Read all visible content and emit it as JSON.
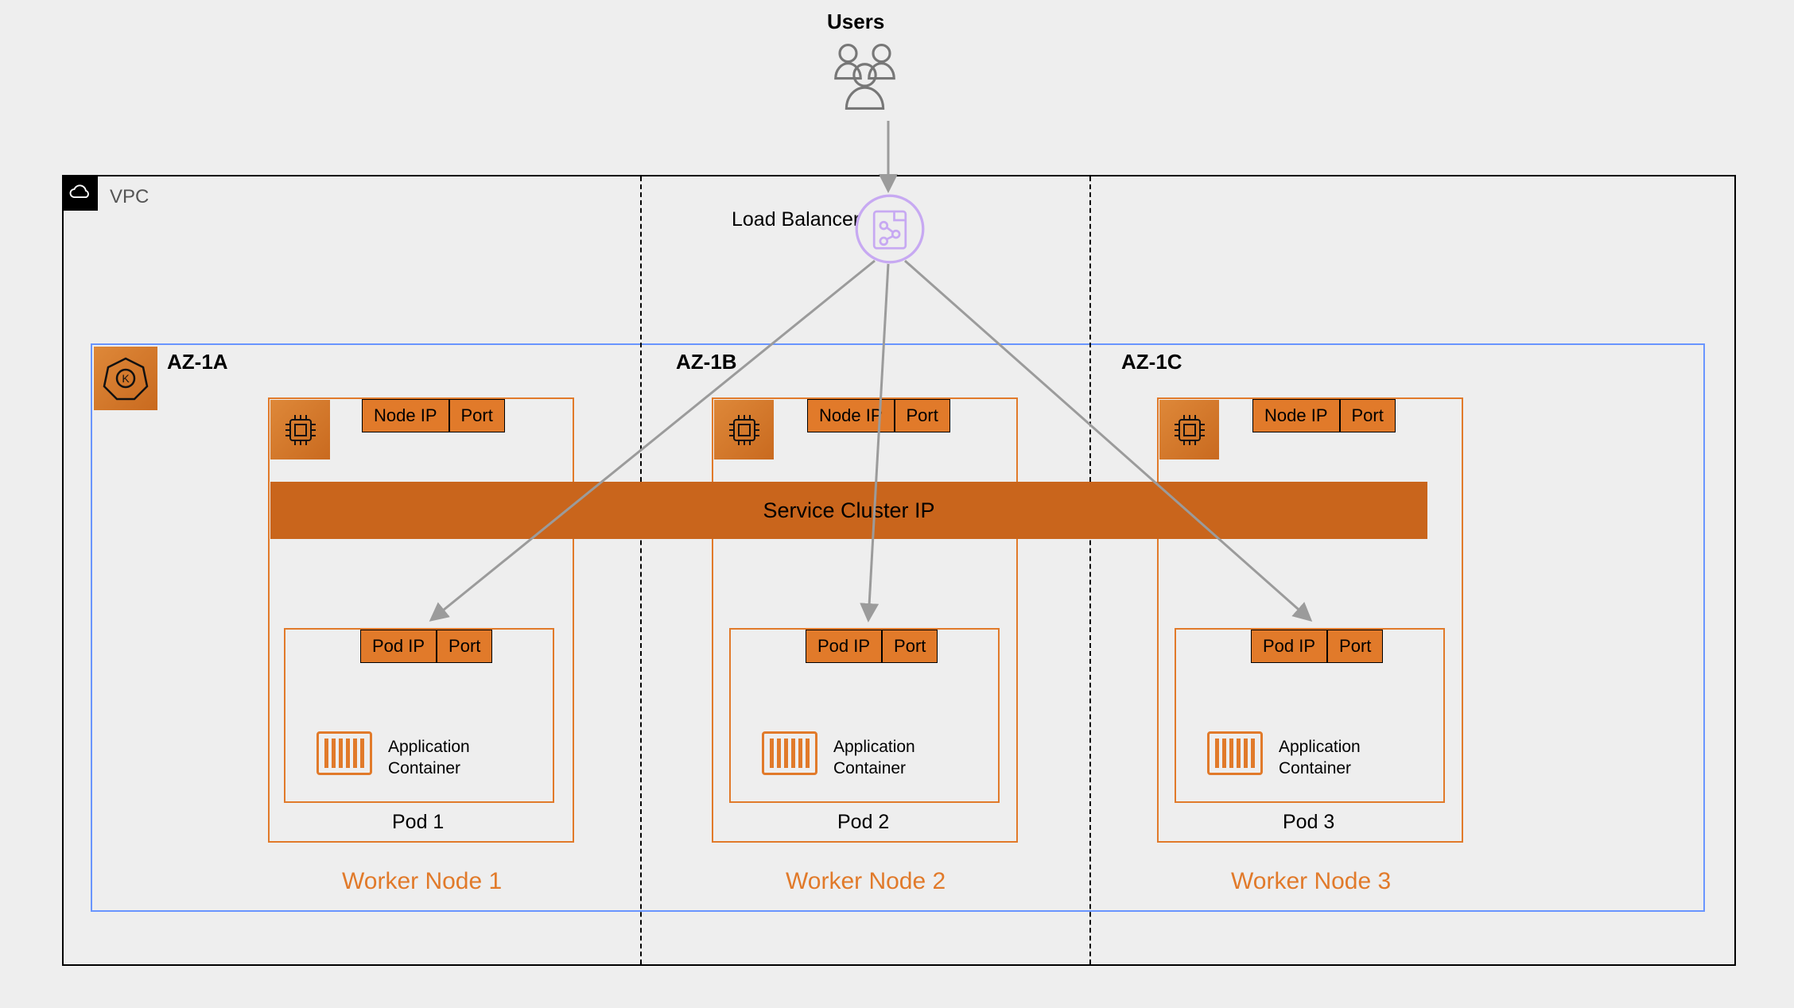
{
  "users_label": "Users",
  "vpc_label": "VPC",
  "lb_label": "Load Balancer",
  "azs": [
    "AZ-1A",
    "AZ-1B",
    "AZ-1C"
  ],
  "node_tab": {
    "ip": "Node IP",
    "port": "Port"
  },
  "service_bar": "Service Cluster IP",
  "pod_tab": {
    "ip": "Pod IP",
    "port": "Port"
  },
  "container_label_l1": "Application",
  "container_label_l2": "Container",
  "pods": [
    "Pod 1",
    "Pod 2",
    "Pod 3"
  ],
  "workers": [
    "Worker Node 1",
    "Worker Node 2",
    "Worker Node 3"
  ],
  "colors": {
    "orange": "#e17a2a",
    "darkorange": "#c9651c",
    "purple": "#b98eee",
    "blue_border": "#6995ff",
    "gray_arrow": "#9b9b9b"
  }
}
